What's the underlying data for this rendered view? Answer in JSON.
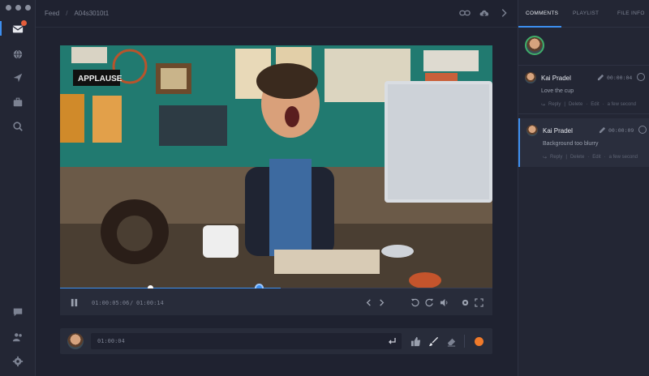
{
  "breadcrumb": {
    "root": "Feed",
    "separator": "/",
    "current": "A04s3010t1"
  },
  "sidebar": {
    "icons": [
      "inbox-icon",
      "globe-icon",
      "send-icon",
      "briefcase-icon",
      "search-icon",
      "chat-icon",
      "users-icon",
      "gear-icon"
    ],
    "accent": "#3d8ff0",
    "notification_color": "#e35d3b"
  },
  "topbar_icons": [
    "link-icon",
    "cloud-download-icon",
    "chevron-right-icon"
  ],
  "player": {
    "current_time": "01:00:05:06",
    "time_separator": "/",
    "duration": "01:00:14",
    "progress": 0.46,
    "marker_position": 0.21,
    "buffered": 0.51
  },
  "comment_bar": {
    "timecode": "01:00:04",
    "record_color": "#f07a2a"
  },
  "panel": {
    "tabs": [
      {
        "label": "COMMENTS",
        "active": true
      },
      {
        "label": "PLAYLIST",
        "active": false
      },
      {
        "label": "FILE INFO",
        "active": false
      }
    ],
    "comments": [
      {
        "author": "Kai Pradel",
        "timecode": "00:00:04",
        "text": "Love the cup",
        "actions": {
          "reply": "Reply",
          "delete": "Delete",
          "edit": "Edit",
          "time": "a few second"
        }
      },
      {
        "author": "Kai Pradel",
        "timecode": "00:00:09",
        "text": "Background too blurry",
        "actions": {
          "reply": "Reply",
          "delete": "Delete",
          "edit": "Edit",
          "time": "a few second"
        }
      }
    ]
  }
}
